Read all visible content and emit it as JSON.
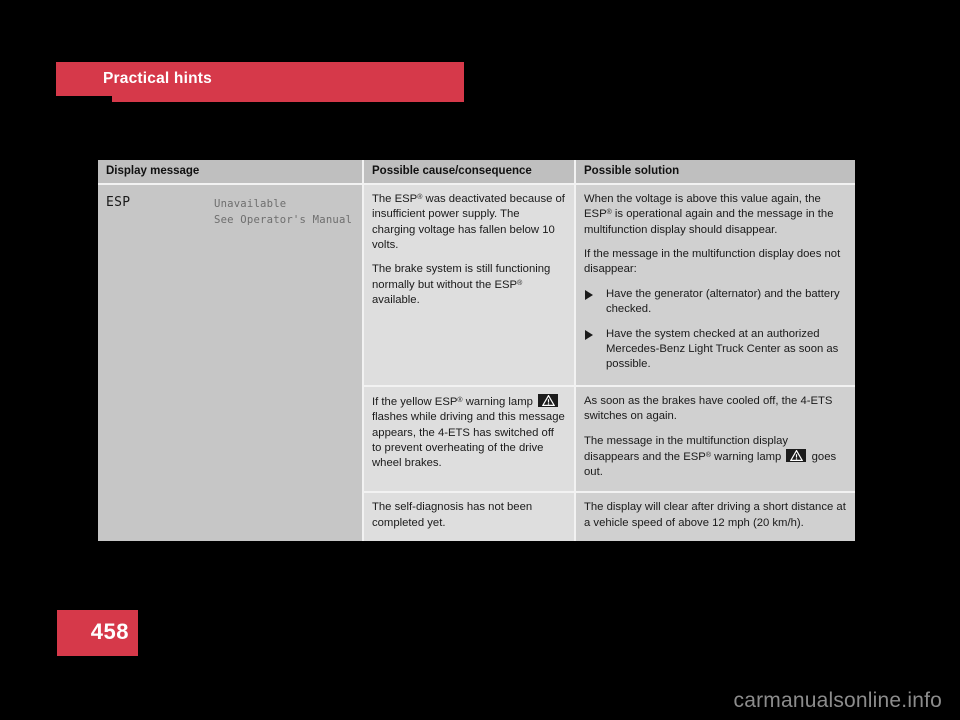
{
  "chapter": {
    "title": "Practical hints",
    "bar_color": "#d6394a",
    "text_color": "#ffffff"
  },
  "page": {
    "number": "458",
    "badge_color": "#d6394a"
  },
  "watermark": {
    "text": "carmanualsonline.info",
    "color": "#8c8c8c"
  },
  "table": {
    "headers": {
      "display_message": "Display message",
      "possible_cause": "Possible cause/consequence",
      "possible_solution": "Possible solution"
    },
    "display_message": {
      "code": "ESP",
      "line1": "Unavailable",
      "line2": "See Operator's Manual"
    },
    "rows": [
      {
        "cause": {
          "p1_a": "The ESP",
          "p1_reg": "®",
          "p1_b": " was deactivated because of insufficient power supply. The charging voltage has fallen below 10 volts.",
          "p2_a": "The brake system is still functioning normally but without the ESP",
          "p2_reg": "®",
          "p2_b": " available."
        },
        "solution": {
          "p1_a": "When the voltage is above this value again, the ESP",
          "p1_reg": "®",
          "p1_b": " is operational again and the message in the multifunction display should disappear.",
          "p2": "If the message in the multifunction display does not disappear:",
          "bullets": [
            "Have the generator (alternator) and the battery checked.",
            "Have the system checked at an authorized Mercedes-Benz Light Truck Center as soon as possible."
          ]
        }
      },
      {
        "cause": {
          "p1_a": "If the yellow ESP",
          "p1_reg": "®",
          "p1_b": " warning lamp ",
          "p1_icon": "warning-triangle-lamp-icon",
          "p1_c": " flashes while driving and this message appears, the 4-ETS has switched off to prevent overheating of the drive wheel brakes."
        },
        "solution": {
          "p1": "As soon as the brakes have cooled off, the 4-ETS switches on again.",
          "p2_a": "The message in the multifunction display disappears and the ESP",
          "p2_reg": "®",
          "p2_b": " warning lamp ",
          "p2_icon": "warning-triangle-lamp-icon",
          "p2_c": " goes out."
        }
      },
      {
        "cause": {
          "p1": "The self-diagnosis has not been completed yet."
        },
        "solution": {
          "p1": "The display will clear after driving a short distance at a vehicle speed of above 12 mph (20 km/h)."
        }
      }
    ]
  }
}
